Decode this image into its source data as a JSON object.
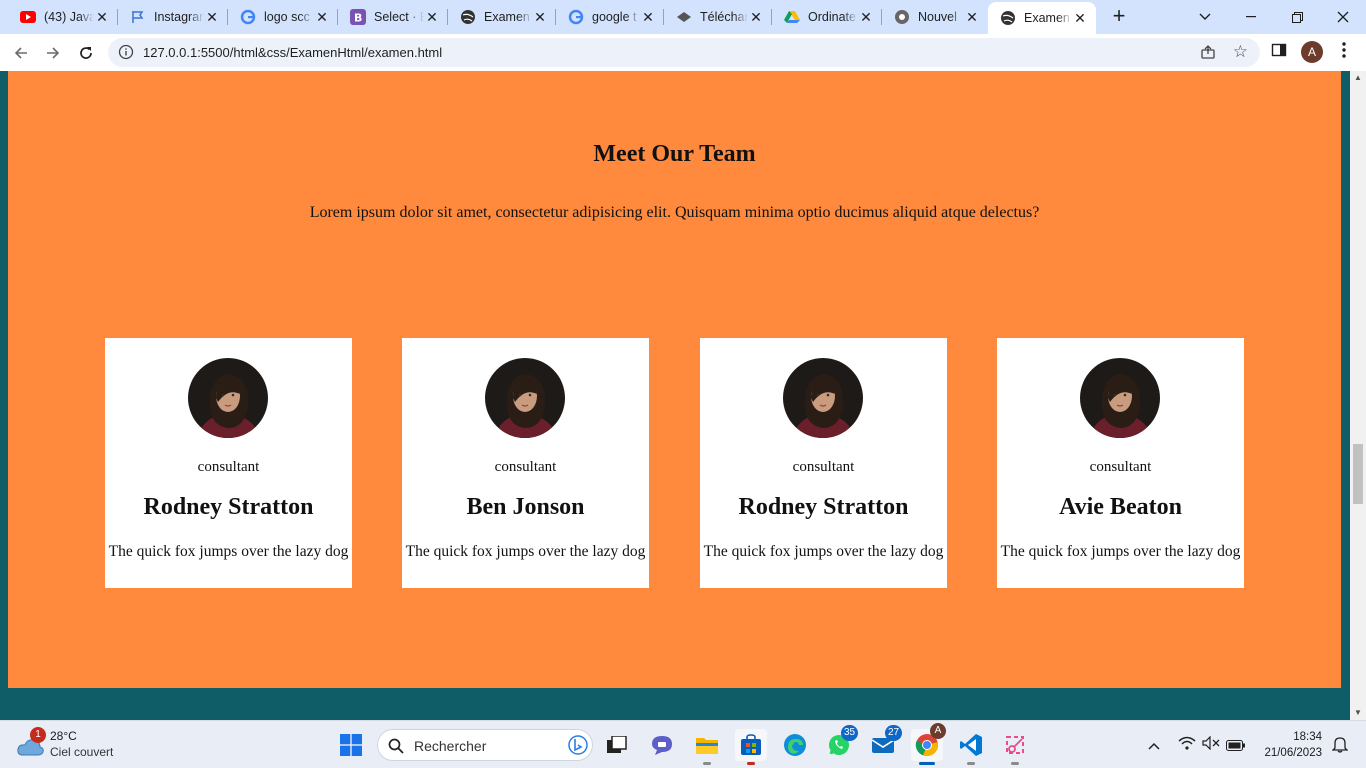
{
  "browser": {
    "tabs": [
      {
        "title": "(43) Java",
        "icon": "youtube-icon"
      },
      {
        "title": "Instagram",
        "icon": "flag-icon"
      },
      {
        "title": "logo scc",
        "icon": "google-icon"
      },
      {
        "title": "Select · B",
        "icon": "bootstrap-icon"
      },
      {
        "title": "Examen",
        "icon": "globe-icon"
      },
      {
        "title": "google t",
        "icon": "google-icon"
      },
      {
        "title": "Téléchar",
        "icon": "diamond-icon"
      },
      {
        "title": "Ordinate",
        "icon": "drive-icon"
      },
      {
        "title": "Nouvel",
        "icon": "chrome-icon"
      },
      {
        "title": "Examen",
        "icon": "globe-icon",
        "active": true
      }
    ],
    "new_tab_label": "+",
    "url": "127.0.0.1:5500/html&css/ExamenHtml/examen.html",
    "profile_initial": "A"
  },
  "page": {
    "title": "Meet Our Team",
    "description": "Lorem ipsum dolor sit amet, consectetur adipisicing elit. Quisquam minima optio ducimus aliquid atque delectus?",
    "members": [
      {
        "role": "consultant",
        "name": "Rodney Stratton",
        "bio": "The quick fox jumps over the lazy dog"
      },
      {
        "role": "consultant",
        "name": "Ben Jonson",
        "bio": "The quick fox jumps over the lazy dog"
      },
      {
        "role": "consultant",
        "name": "Rodney Stratton",
        "bio": "The quick fox jumps over the lazy dog"
      },
      {
        "role": "consultant",
        "name": "Avie Beaton",
        "bio": "The quick fox jumps over the lazy dog"
      }
    ]
  },
  "taskbar": {
    "weather": {
      "temp": "28°C",
      "desc": "Ciel couvert",
      "badge": "1"
    },
    "search_placeholder": "Rechercher",
    "badges": {
      "whatsapp": "35",
      "mail": "27",
      "chrome_profile": "A"
    },
    "time": "18:34",
    "date": "21/06/2023"
  },
  "colors": {
    "page_background": "#0f5d66",
    "section_background": "#ff8a3d",
    "card_background": "#ffffff",
    "tabstrip": "#d3e3fd"
  }
}
